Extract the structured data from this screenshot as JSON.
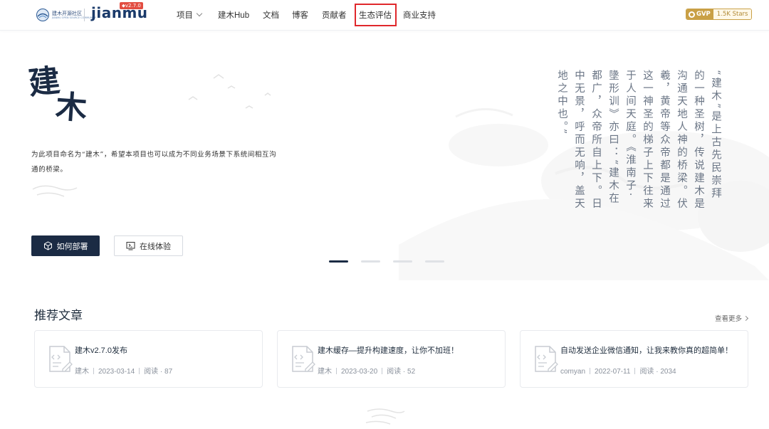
{
  "header": {
    "org_logo": {
      "name_cn": "建木开源社区",
      "name_en": "JIANMU OPEN SOURCE COMMUNITY"
    },
    "brand": "jianmu",
    "version": "v2.7.0",
    "nav": [
      {
        "label": "项目",
        "has_dropdown": true
      },
      {
        "label": "建木Hub"
      },
      {
        "label": "文档"
      },
      {
        "label": "博客"
      },
      {
        "label": "贡献者"
      },
      {
        "label": "生态评估",
        "highlighted": true
      },
      {
        "label": "商业支持"
      }
    ],
    "gvp": {
      "label": "GVP",
      "stars": "1.5K Stars"
    }
  },
  "hero": {
    "title_line1": "建",
    "title_line2": "木",
    "description": "为此项目命名为“建木”，希望本项目也可以成为不同业务场景下系统间相互沟通的桥梁。",
    "buttons": {
      "deploy": "如何部署",
      "try_online": "在线体验"
    },
    "poem_columns": [
      "“建木”是上古先民崇拜",
      "的一种圣树，传说建木是",
      "沟通天地人神的桥梁。伏",
      "羲，黄帝等众帝都是通过",
      "这一神圣的梯子上下往来",
      "于人间天庭。《淮南子·",
      "墬形训》亦曰：“建木在",
      "都广，众帝所自上下。日",
      "中无景，呼而无响，盖天",
      "地之中也。”"
    ],
    "carousel": {
      "count": 4,
      "active_index": 0
    }
  },
  "articles": {
    "section_title": "推荐文章",
    "see_more": "查看更多",
    "items": [
      {
        "title": "建木v2.7.0发布",
        "author": "建木",
        "date": "2023-03-14",
        "reads": "阅读 · 87"
      },
      {
        "title": "建木缓存—提升构建速度，让你不加班！",
        "author": "建木",
        "date": "2023-03-20",
        "reads": "阅读 · 52"
      },
      {
        "title": "自动发送企业微信通知，让我来教你真的超简单！",
        "author": "comyan",
        "date": "2022-07-11",
        "reads": "阅读 · 2034"
      }
    ]
  },
  "colors": {
    "primary_dark": "#1b2b44",
    "highlight_red": "#e0282c",
    "version_red": "#e24d41",
    "gvp_gold": "#c9a046"
  }
}
